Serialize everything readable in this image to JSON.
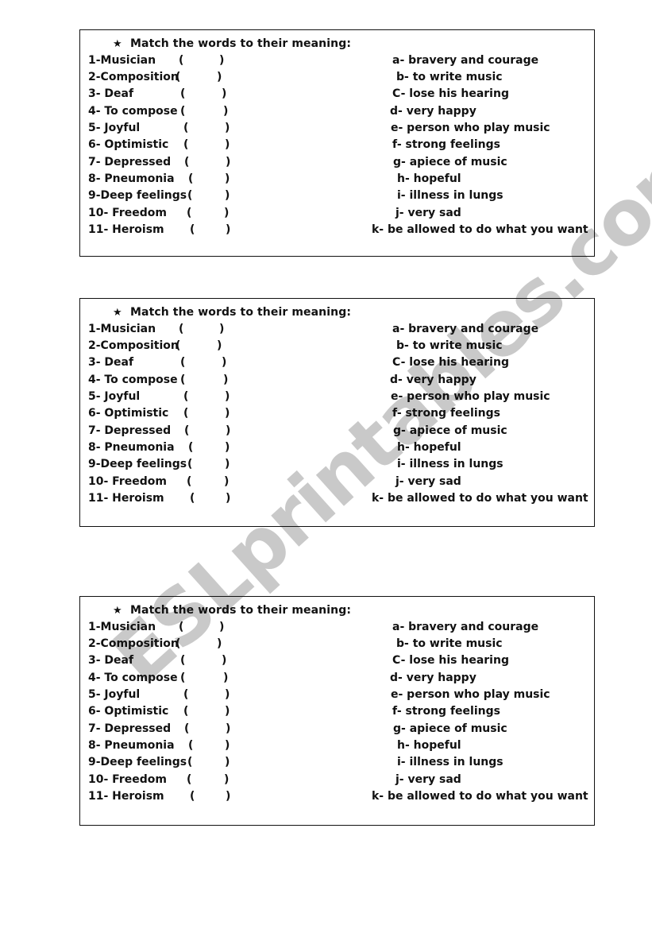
{
  "watermark": "ESLprintables.com",
  "exercise": {
    "star_icon": "★",
    "title": "Match the words to their meaning:",
    "words": [
      "1-Musician",
      "2-Composition",
      "3- Deaf",
      "4- To compose",
      "5- Joyful",
      "6- Optimistic",
      "7- Depressed",
      "8- Pneumonia",
      "9-Deep feelings",
      "10- Freedom",
      "11- Heroism"
    ],
    "open_paren": "(",
    "close_paren": ")",
    "definitions": [
      "a- bravery and courage",
      "b- to write music",
      "C- lose his hearing",
      "d- very happy",
      "e- person who play music",
      "f- strong feelings",
      "g- apiece of music",
      "h- hopeful",
      "i- illness in lungs",
      "j- very sad",
      "k- be allowed to do what you want"
    ]
  }
}
